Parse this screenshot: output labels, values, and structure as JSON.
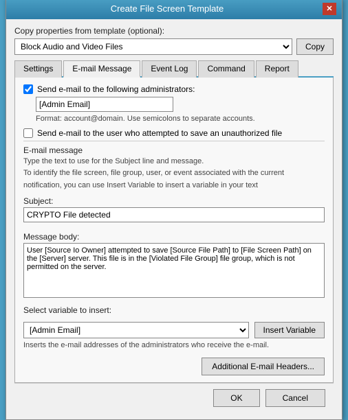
{
  "dialog": {
    "title": "Create File Screen Template",
    "close_label": "✕"
  },
  "copy_section": {
    "label": "Copy properties from template (optional):",
    "selected_template": "Block Audio and Video Files",
    "copy_button": "Copy"
  },
  "tabs": [
    {
      "id": "settings",
      "label": "Settings",
      "active": false
    },
    {
      "id": "email",
      "label": "E-mail Message",
      "active": true
    },
    {
      "id": "event_log",
      "label": "Event Log",
      "active": false
    },
    {
      "id": "command",
      "label": "Command",
      "active": false
    },
    {
      "id": "report",
      "label": "Report",
      "active": false
    }
  ],
  "email_tab": {
    "send_admin_checked": true,
    "send_admin_label": "Send e-mail to the following administrators:",
    "admin_email_value": "[Admin Email]",
    "format_hint": "Format: account@domain. Use semicolons to separate accounts.",
    "send_user_label": "Send e-mail to the user who attempted to save an unauthorized file",
    "send_user_checked": false,
    "email_message_label": "E-mail message",
    "description_line1": "Type the text to use for the Subject line and message.",
    "description_line2": "To identify the file screen, file group, user, or event associated with the current",
    "description_line3": "notification, you can use Insert Variable to insert a variable in your text",
    "subject_label": "Subject:",
    "subject_value": "CRYPTO File detected",
    "message_label": "Message body:",
    "message_value": "User [Source Io Owner] attempted to save [Source File Path] to [File Screen Path] on the [Server] server. This file is in the [Violated File Group] file group, which is not permitted on the server.",
    "variable_label": "Select variable to insert:",
    "variable_value": "[Admin Email]",
    "insert_button": "Insert Variable",
    "variable_hint": "Inserts the e-mail addresses of the administrators who receive the e-mail.",
    "additional_btn": "Additional E-mail Headers..."
  },
  "footer": {
    "ok_label": "OK",
    "cancel_label": "Cancel"
  }
}
